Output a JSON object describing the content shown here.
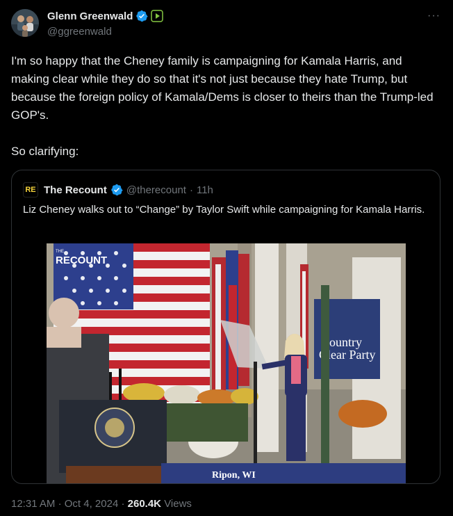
{
  "author": {
    "name": "Glenn Greenwald",
    "handle": "@ggreenwald"
  },
  "tweet": {
    "text": "I'm so happy that the Cheney family is campaigning for Kamala Harris, and making clear while they do so that it's not just because they hate Trump, but because the foreign policy of Kamala/Dems is closer to theirs than the Trump-led GOP's.\n\nSo clarifying:"
  },
  "quote": {
    "logo_text": "RE",
    "name": "The Recount",
    "handle": "@therecount",
    "separator": "·",
    "time": "11h",
    "text": "Liz Cheney walks out to “Change” by Taylor Swift while campaigning for Kamala Harris.",
    "video": {
      "watermark": "THE\nRECOUNT",
      "sign_text": "Country\nClear Party",
      "banner_text": "Ripon, WI"
    }
  },
  "footer": {
    "time": "12:31 AM",
    "sep1": "·",
    "date": "Oct 4, 2024",
    "sep2": "·",
    "views_count": "260.4K",
    "views_label": "Views"
  },
  "colors": {
    "verified": "#1d9bf0",
    "muted": "#71767b",
    "text": "#e7e9ea",
    "border": "#2f3336",
    "rumble": "#85c742"
  }
}
